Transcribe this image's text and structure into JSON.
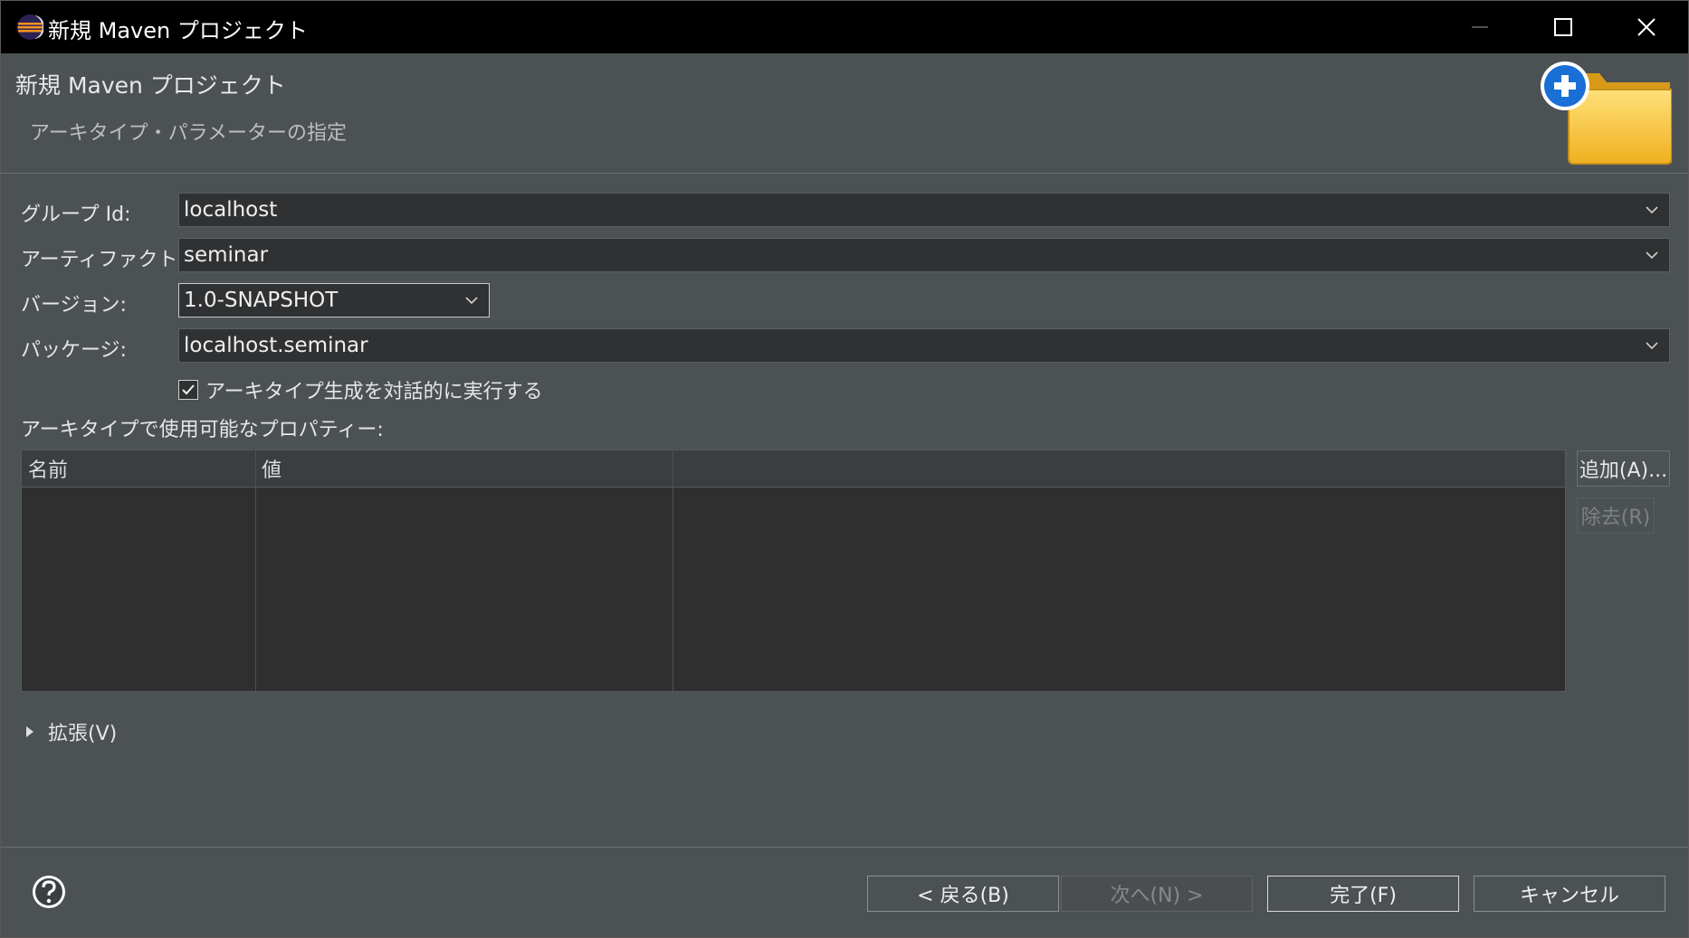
{
  "window": {
    "title": "新規 Maven プロジェクト"
  },
  "banner": {
    "title": "新規 Maven プロジェクト",
    "description": "アーキタイプ・パラメーターの指定",
    "icon": "new-folder-plus-icon"
  },
  "form": {
    "group_id": {
      "label": "グループ Id:",
      "value": "localhost"
    },
    "artifact_id": {
      "label": "アーティファクト Id:",
      "value": "seminar"
    },
    "version": {
      "label": "バージョン:",
      "value": "1.0-SNAPSHOT"
    },
    "package": {
      "label": "パッケージ:",
      "value": "localhost.seminar"
    },
    "interactive_checkbox": {
      "label": "アーキタイプ生成を対話的に実行する",
      "checked": true
    }
  },
  "properties": {
    "label": "アーキタイプで使用可能なプロパティー:",
    "columns": [
      "名前",
      "値"
    ],
    "rows": [],
    "add_button": "追加(A)...",
    "remove_button": "除去(R)"
  },
  "advanced": {
    "label": "拡張(V)"
  },
  "footer": {
    "back": "< 戻る(B)",
    "next": "次へ(N) >",
    "finish": "完了(F)",
    "cancel": "キャンセル"
  },
  "colors": {
    "titlebar": "#000000",
    "dialog_bg": "#4c5154",
    "field_bg": "#2f3133",
    "table_bg": "#2f2f2f",
    "icon_blue": "#1a6fd6",
    "folder_yellow": "#f6c23a"
  }
}
